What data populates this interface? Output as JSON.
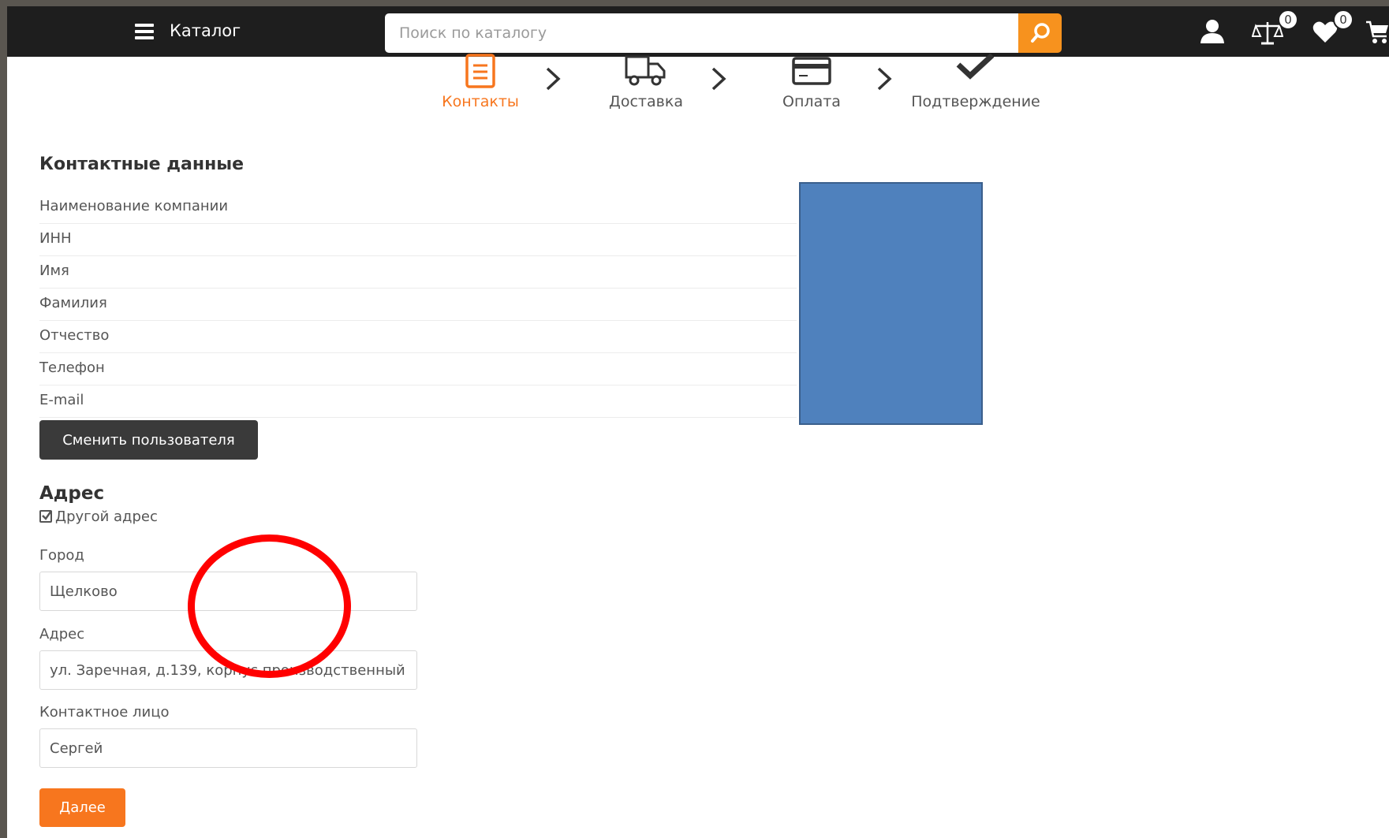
{
  "header": {
    "menu_icon": "hamburger-icon",
    "catalog_label": "Каталог",
    "search": {
      "placeholder": "Поиск по каталогу",
      "value": ""
    },
    "icons": [
      "search-icon",
      "user-icon",
      "compare-scales-icon",
      "heart-icon",
      "cart-icon"
    ],
    "compare_count": "0",
    "favorites_count": "0"
  },
  "steps": [
    {
      "label": "Контакты",
      "icon": "clipboard-icon",
      "active": true
    },
    {
      "label": "Доставка",
      "icon": "truck-icon",
      "active": false
    },
    {
      "label": "Оплата",
      "icon": "credit-card-icon",
      "active": false
    },
    {
      "label": "Подтверждение",
      "icon": "checkmark-icon",
      "active": false
    }
  ],
  "contacts": {
    "title": "Контактные данные",
    "fields": [
      "Наименование компании",
      "ИНН",
      "Имя",
      "Фамилия",
      "Отчество",
      "Телефон",
      "E-mail"
    ],
    "change_user_button": "Сменить пользователя"
  },
  "address": {
    "title": "Адрес",
    "other_address_label": "Другой адрес",
    "other_address_checked": true,
    "city_label": "Город",
    "city_value": "Щелково",
    "address_label": "Адрес",
    "address_value": "ул. Заречная, д.139, корпус производственный",
    "contact_label": "Контактное лицо",
    "contact_value": "Сергей"
  },
  "next_button": "Далее",
  "colors": {
    "accent": "#f7921e",
    "topbar": "#1e1e1e",
    "redaction": "#4f81bd",
    "annotation": "#ff0000"
  }
}
